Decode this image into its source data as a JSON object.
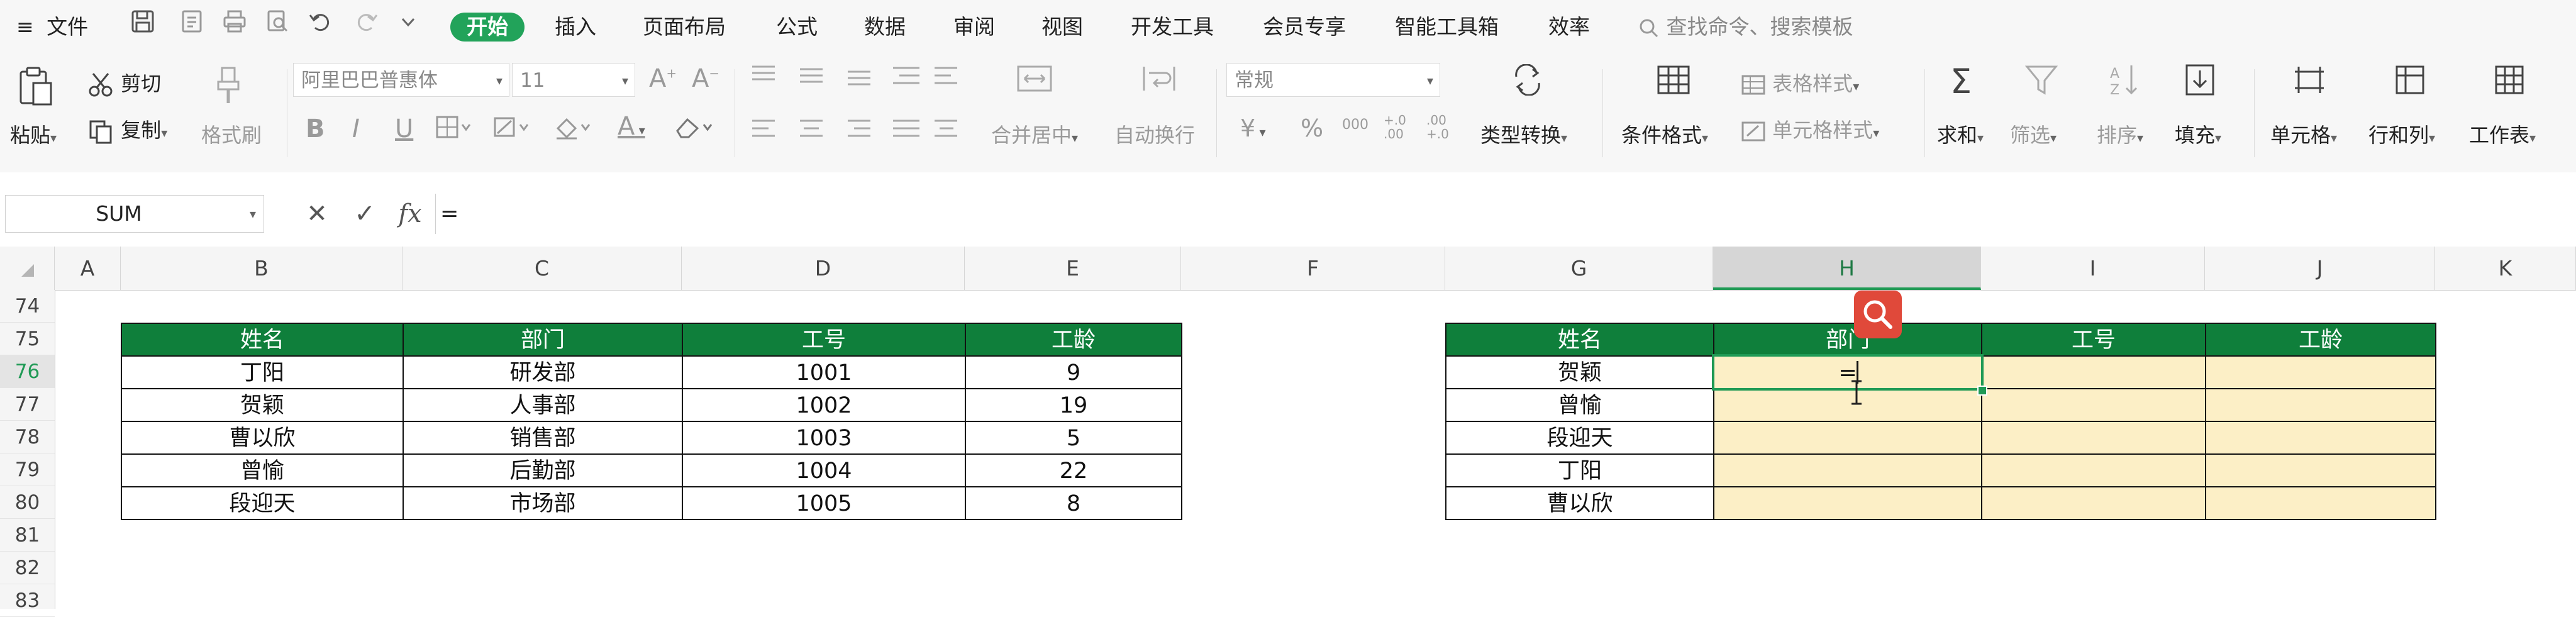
{
  "menu": {
    "hamburger": "≡",
    "file": "文件",
    "tabs": [
      "开始",
      "插入",
      "页面布局",
      "公式",
      "数据",
      "审阅",
      "视图",
      "开发工具",
      "会员专享",
      "智能工具箱",
      "效率"
    ],
    "search": "查找命令、搜索模板"
  },
  "ribbon": {
    "paste": "粘贴",
    "cut": "剪切",
    "copy": "复制",
    "format_painter": "格式刷",
    "font_name": "阿里巴巴普惠体",
    "font_size": "11",
    "merge_center": "合并居中",
    "wrap_text": "自动换行",
    "number_format": "常规",
    "type_convert": "类型转换",
    "conditional_format": "条件格式",
    "table_style": "表格样式",
    "cell_style": "单元格样式",
    "sum": "求和",
    "filter": "筛选",
    "sort": "排序",
    "fill": "填充",
    "cell": "单元格",
    "row_col": "行和列",
    "worksheet": "工作表",
    "bold": "B",
    "italic": "I",
    "underline": "U",
    "font_color_letter": "A",
    "currency": "¥",
    "percent": "%",
    "thousands": "000",
    "inc_decimal": "+.0 .00",
    "dec_decimal": ".00 +.0"
  },
  "formula_bar": {
    "name_box": "SUM",
    "cancel": "✕",
    "confirm": "✓",
    "fx": "fx",
    "content": "="
  },
  "columns": [
    "A",
    "B",
    "C",
    "D",
    "E",
    "F",
    "G",
    "H",
    "I",
    "J",
    "K"
  ],
  "rows": [
    "74",
    "75",
    "76",
    "77",
    "78",
    "79",
    "80",
    "81",
    "82",
    "83"
  ],
  "left_table": {
    "headers": [
      "姓名",
      "部门",
      "工号",
      "工龄"
    ],
    "rows": [
      [
        "丁阳",
        "研发部",
        "1001",
        "9"
      ],
      [
        "贺颖",
        "人事部",
        "1002",
        "19"
      ],
      [
        "曹以欣",
        "销售部",
        "1003",
        "5"
      ],
      [
        "曾愉",
        "后勤部",
        "1004",
        "22"
      ],
      [
        "段迎天",
        "市场部",
        "1005",
        "8"
      ]
    ]
  },
  "right_table": {
    "headers": [
      "姓名",
      "部门",
      "工号",
      "工龄"
    ],
    "names": [
      "贺颖",
      "曾愉",
      "段迎天",
      "丁阳",
      "曹以欣"
    ],
    "editing_value": "="
  },
  "colors": {
    "accent": "#22a35a",
    "header_green": "#0f7f3b",
    "yellow_fill": "#fcefc6",
    "zoom_red": "#e0493a"
  }
}
